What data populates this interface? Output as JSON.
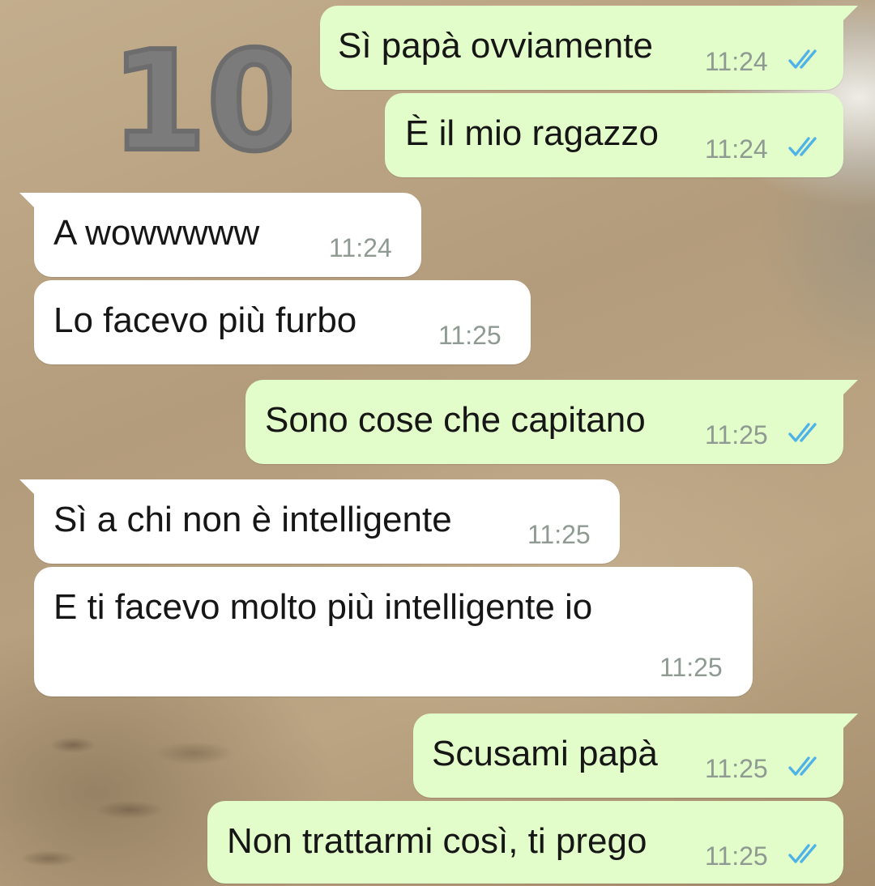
{
  "sticker": {
    "text": "10"
  },
  "colors": {
    "outgoing": "#e2fdc9",
    "incoming": "#ffffff",
    "read_ticks": "#4fb3e8"
  },
  "messages": [
    {
      "direction": "outgoing",
      "text": "Sì papà ovviamente",
      "time": "11:24",
      "status": "read"
    },
    {
      "direction": "outgoing",
      "text": "È il mio ragazzo",
      "time": "11:24",
      "status": "read"
    },
    {
      "direction": "incoming",
      "text": "A wowwwww",
      "time": "11:24"
    },
    {
      "direction": "incoming",
      "text": "Lo facevo più furbo",
      "time": "11:25"
    },
    {
      "direction": "outgoing",
      "text": "Sono cose che capitano",
      "time": "11:25",
      "status": "read"
    },
    {
      "direction": "incoming",
      "text": "Sì a chi non è intelligente",
      "time": "11:25"
    },
    {
      "direction": "incoming",
      "text": "E ti facevo molto più intelligente io",
      "time": "11:25"
    },
    {
      "direction": "outgoing",
      "text": "Scusami papà",
      "time": "11:25",
      "status": "read"
    },
    {
      "direction": "outgoing",
      "text": "Non trattarmi così, ti prego",
      "time": "11:25",
      "status": "read"
    }
  ]
}
